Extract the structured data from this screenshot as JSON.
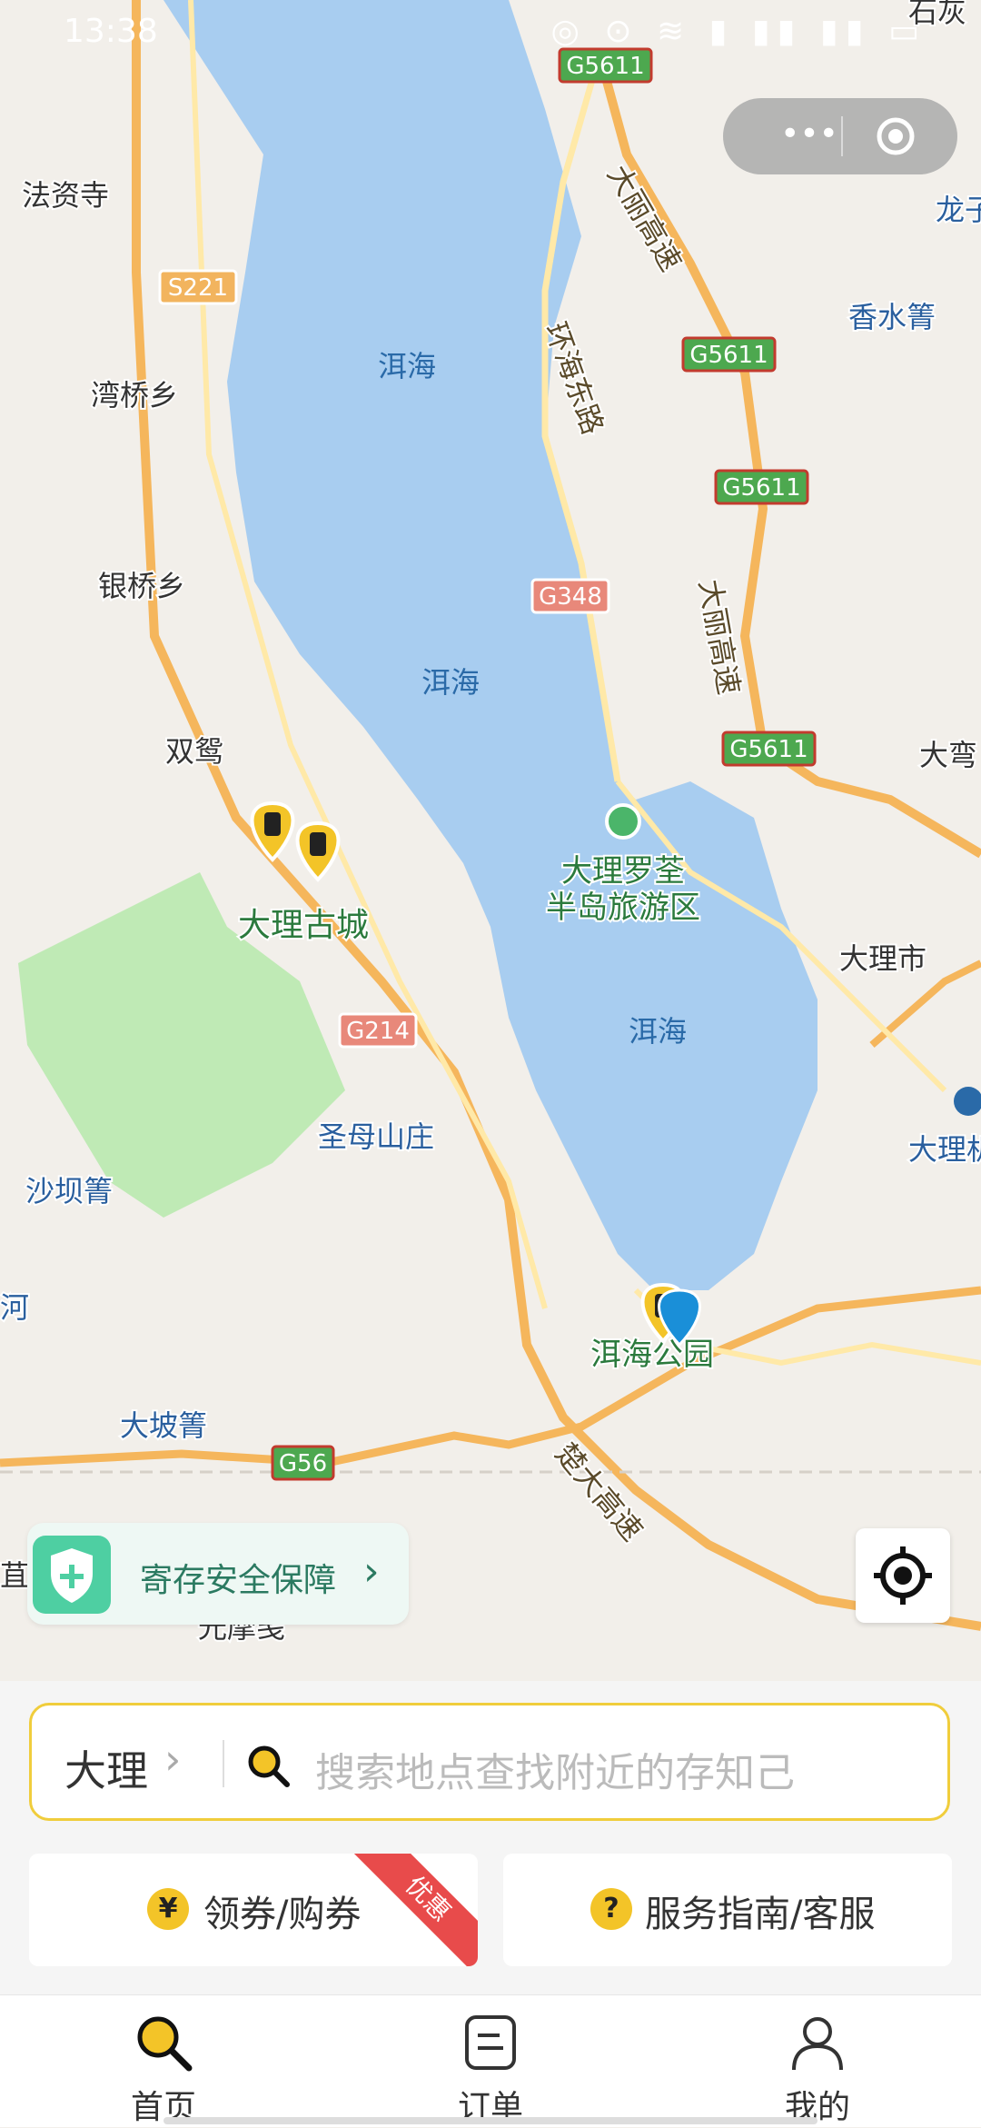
{
  "status_bar": {
    "time": "13:38",
    "icons": "◎ ⊙ ≋ ▮ ▮▮ ▮▮ ▭"
  },
  "capsule": {
    "more_label": "•••",
    "icon_more": "more-dots-icon",
    "icon_close": "close-circle-icon"
  },
  "map": {
    "road_shields": [
      "G5611",
      "G5611",
      "G5611",
      "G5611",
      "S221",
      "G348",
      "G214",
      "G56"
    ],
    "place_labels": [
      "法资寺",
      "湾桥乡",
      "银桥乡",
      "双鸳",
      "大理古城",
      "圣母山庄",
      "沙坝箐",
      "大坡箐",
      "光摩笺",
      "石灰",
      "龙子",
      "香水箐",
      "大弯",
      "大理市",
      "大理机",
      "河",
      "苴"
    ],
    "lake_labels": [
      "洱海",
      "洱海",
      "洱海"
    ],
    "road_labels": [
      "大丽高速",
      "环海东路",
      "大丽高速",
      "楚大高速"
    ],
    "poi_labels": [
      "大理罗荃\n半岛旅游区",
      "洱海公园"
    ],
    "colors": {
      "water": "#a8cdf0",
      "land": "#f2efea",
      "park": "#bfeab5",
      "highway": "#f5b65c",
      "road": "#ffe9a8"
    }
  },
  "safety_badge": {
    "label": "寄存安全保障",
    "icon": "shield-plus-icon"
  },
  "locate_button": {
    "icon": "locate-crosshair-icon"
  },
  "search": {
    "city": "大理",
    "placeholder": "搜索地点查找附近的存知己",
    "icon": "search-icon"
  },
  "actions": {
    "coupon": {
      "label": "领券/购券",
      "icon_glyph": "¥",
      "ribbon": "优惠"
    },
    "service": {
      "label": "服务指南/客服",
      "icon_glyph": "?"
    }
  },
  "tabs": [
    {
      "label": "首页",
      "icon": "home-search-icon"
    },
    {
      "label": "订单",
      "icon": "order-list-icon"
    },
    {
      "label": "我的",
      "icon": "profile-icon"
    }
  ]
}
